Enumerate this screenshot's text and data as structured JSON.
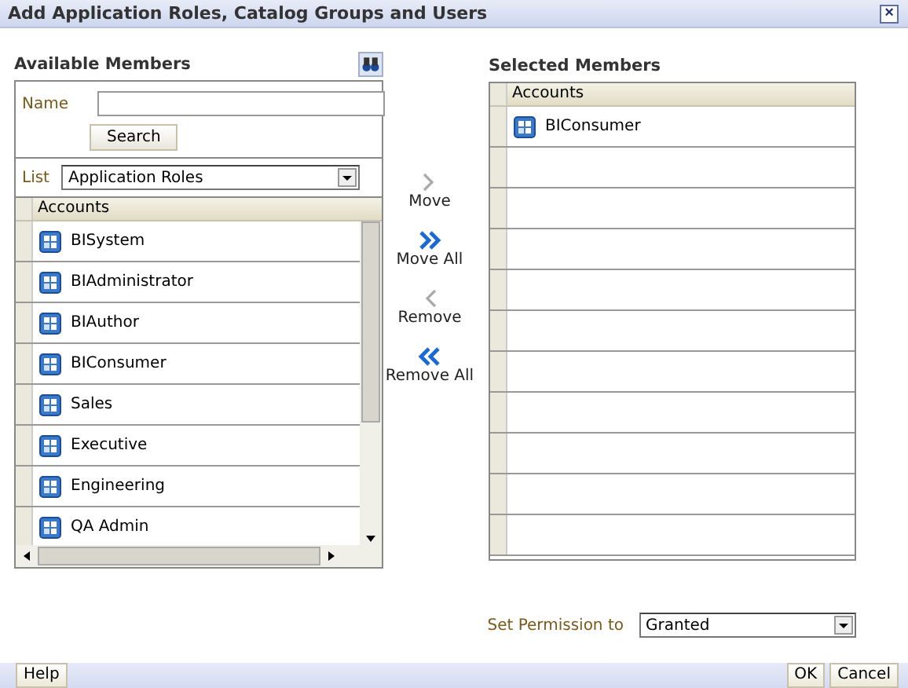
{
  "window": {
    "title": "Add Application Roles, Catalog Groups and Users",
    "close": "×"
  },
  "available": {
    "heading": "Available Members",
    "name_label": "Name",
    "search_button": "Search",
    "list_label": "List",
    "list_value": "Application Roles",
    "column": "Accounts",
    "rows": [
      {
        "name": "BISystem"
      },
      {
        "name": "BIAdministrator"
      },
      {
        "name": "BIAuthor"
      },
      {
        "name": "BIConsumer"
      },
      {
        "name": "Sales"
      },
      {
        "name": "Executive"
      },
      {
        "name": "Engineering"
      },
      {
        "name": "QA Admin"
      }
    ]
  },
  "actions": [
    {
      "label": "Move",
      "kind": "move"
    },
    {
      "label": "Move All",
      "kind": "move_all"
    },
    {
      "label": "Remove",
      "kind": "remove"
    },
    {
      "label": "Remove All",
      "kind": "remove_all"
    }
  ],
  "selected": {
    "heading": "Selected Members",
    "column": "Accounts",
    "rows": [
      {
        "name": "BIConsumer"
      }
    ]
  },
  "permission": {
    "label": "Set Permission to",
    "value": "Granted"
  },
  "footer": {
    "help": "Help",
    "ok": "OK",
    "cancel": "Cancel"
  }
}
